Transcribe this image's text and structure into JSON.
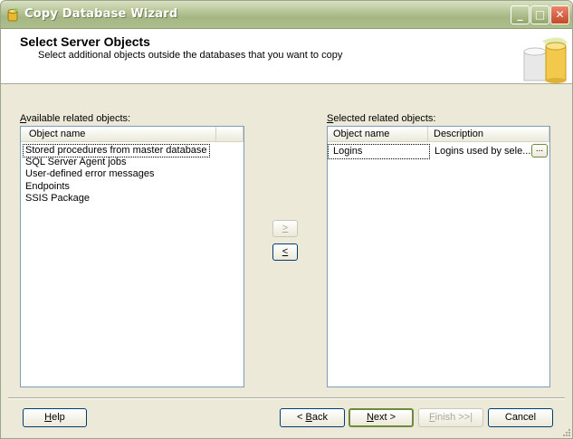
{
  "window": {
    "title": "Copy Database Wizard",
    "controls": {
      "minimize": "_",
      "maximize": "□",
      "close": "✕"
    },
    "accent_color": "#a4b683"
  },
  "header": {
    "title": "Select Server Objects",
    "subtitle": "Select additional objects outside the databases that you want to copy",
    "icon": "database-wizard-icon"
  },
  "available": {
    "label_mnemonic": "A",
    "label_rest": "vailable related objects:",
    "column_header": "Object name",
    "items": [
      "Stored procedures from master database",
      "SQL Server Agent jobs",
      "User-defined error messages",
      "Endpoints",
      "SSIS Package"
    ]
  },
  "transfer": {
    "add_label": ">",
    "remove_label": "<"
  },
  "selected": {
    "label_mnemonic": "S",
    "label_rest": "elected related objects:",
    "columns": [
      "Object name",
      "Description"
    ],
    "rows": [
      {
        "name": "Logins",
        "description": "Logins used by sele...",
        "button": "..."
      }
    ]
  },
  "footer": {
    "help": {
      "mnemonic": "H",
      "rest": "elp"
    },
    "back": {
      "prefix": "< ",
      "mnemonic": "B",
      "rest": "ack"
    },
    "next": {
      "mnemonic": "N",
      "rest": "ext >"
    },
    "finish": {
      "mnemonic": "F",
      "rest": "inish >>|"
    },
    "cancel": "Cancel"
  }
}
